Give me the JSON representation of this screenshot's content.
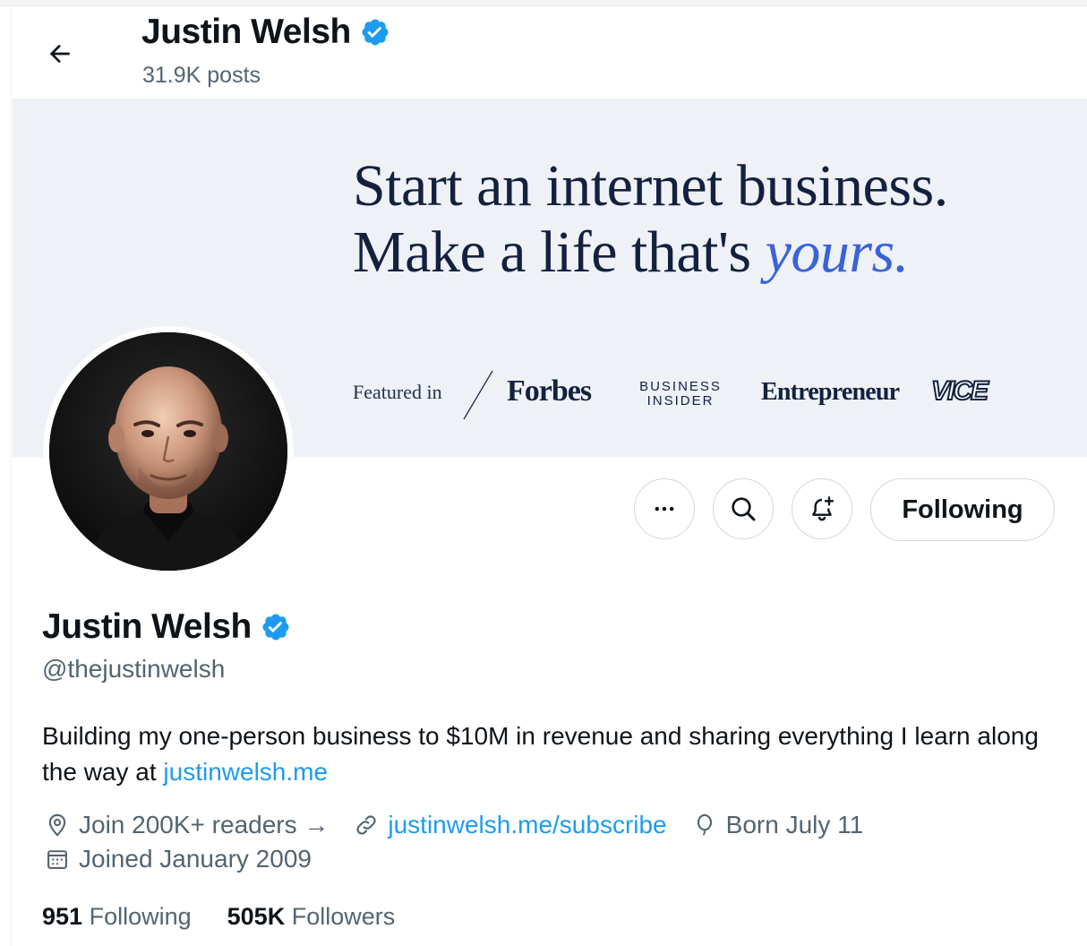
{
  "colors": {
    "accent": "#1d9bf0",
    "verified": "#1d9bf0",
    "text": "#0f1419",
    "muted": "#536471",
    "banner_bg": "#eef1f6",
    "banner_ink": "#13213f",
    "banner_accent": "#3a63d9"
  },
  "header": {
    "name": "Justin Welsh",
    "posts": "31.9K posts",
    "back_icon": "arrow-left-icon"
  },
  "banner": {
    "line1": "Start an internet business.",
    "line2_prefix": "Make a life that's ",
    "line2_accent": "yours.",
    "featured_label": "Featured in",
    "publications": {
      "forbes": "Forbes",
      "bi_line1": "BUSINESS",
      "bi_line2": "INSIDER",
      "entrepreneur": "Entrepreneur",
      "vice": "VICE"
    }
  },
  "actions": {
    "more_icon": "more-icon",
    "search_icon": "search-icon",
    "notify_icon": "bell-plus-icon",
    "following_label": "Following"
  },
  "profile": {
    "name": "Justin Welsh",
    "handle": "@thejustinwelsh",
    "bio_text": "Building my one-person business to $10M in revenue and sharing everything I learn along the way at ",
    "bio_link": "justinwelsh.me",
    "location": "Join 200K+ readers →",
    "website": "justinwelsh.me/subscribe",
    "born": "Born July 11",
    "joined": "Joined January 2009"
  },
  "stats": {
    "following_count": "951",
    "following_label": "Following",
    "followers_count": "505K",
    "followers_label": "Followers"
  }
}
